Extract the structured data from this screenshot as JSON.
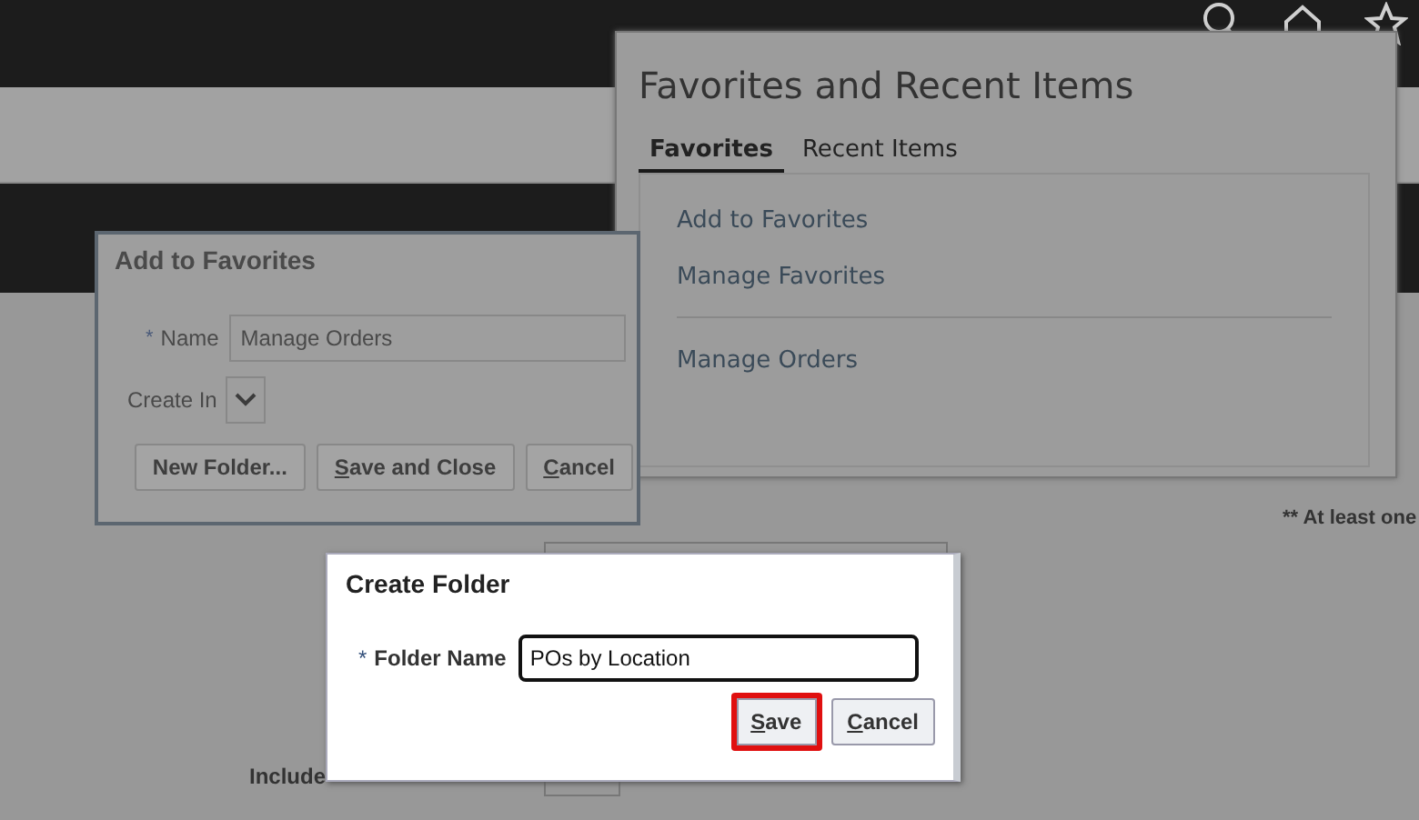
{
  "background": {
    "note": "** At least one",
    "include_label": "Include"
  },
  "favorites_panel": {
    "title": "Favorites and Recent Items",
    "tabs": [
      {
        "label": "Favorites",
        "selected": true
      },
      {
        "label": "Recent Items",
        "selected": false
      }
    ],
    "items": [
      {
        "label": "Add to Favorites",
        "kind": "link"
      },
      {
        "label": "Manage Favorites",
        "kind": "link"
      },
      {
        "kind": "divider"
      },
      {
        "label": "Manage Orders",
        "kind": "link"
      }
    ]
  },
  "add_dialog": {
    "title": "Add to Favorites",
    "name_label": "Name",
    "name_required_mark": "*",
    "name_value": "Manage Orders",
    "create_in_label": "Create In",
    "buttons": [
      {
        "label": "New Folder...",
        "underline_first": false
      },
      {
        "label": "Save and Close",
        "underline_first": true
      },
      {
        "label": "Cancel",
        "underline_first": true
      }
    ]
  },
  "folder_dialog": {
    "title": "Create Folder",
    "field_label": "Folder Name",
    "required_mark": "*",
    "value": "POs by Location",
    "buttons": [
      {
        "label": "Save",
        "underline_first": true,
        "highlighted": true
      },
      {
        "label": "Cancel",
        "underline_first": true,
        "highlighted": false
      }
    ]
  }
}
